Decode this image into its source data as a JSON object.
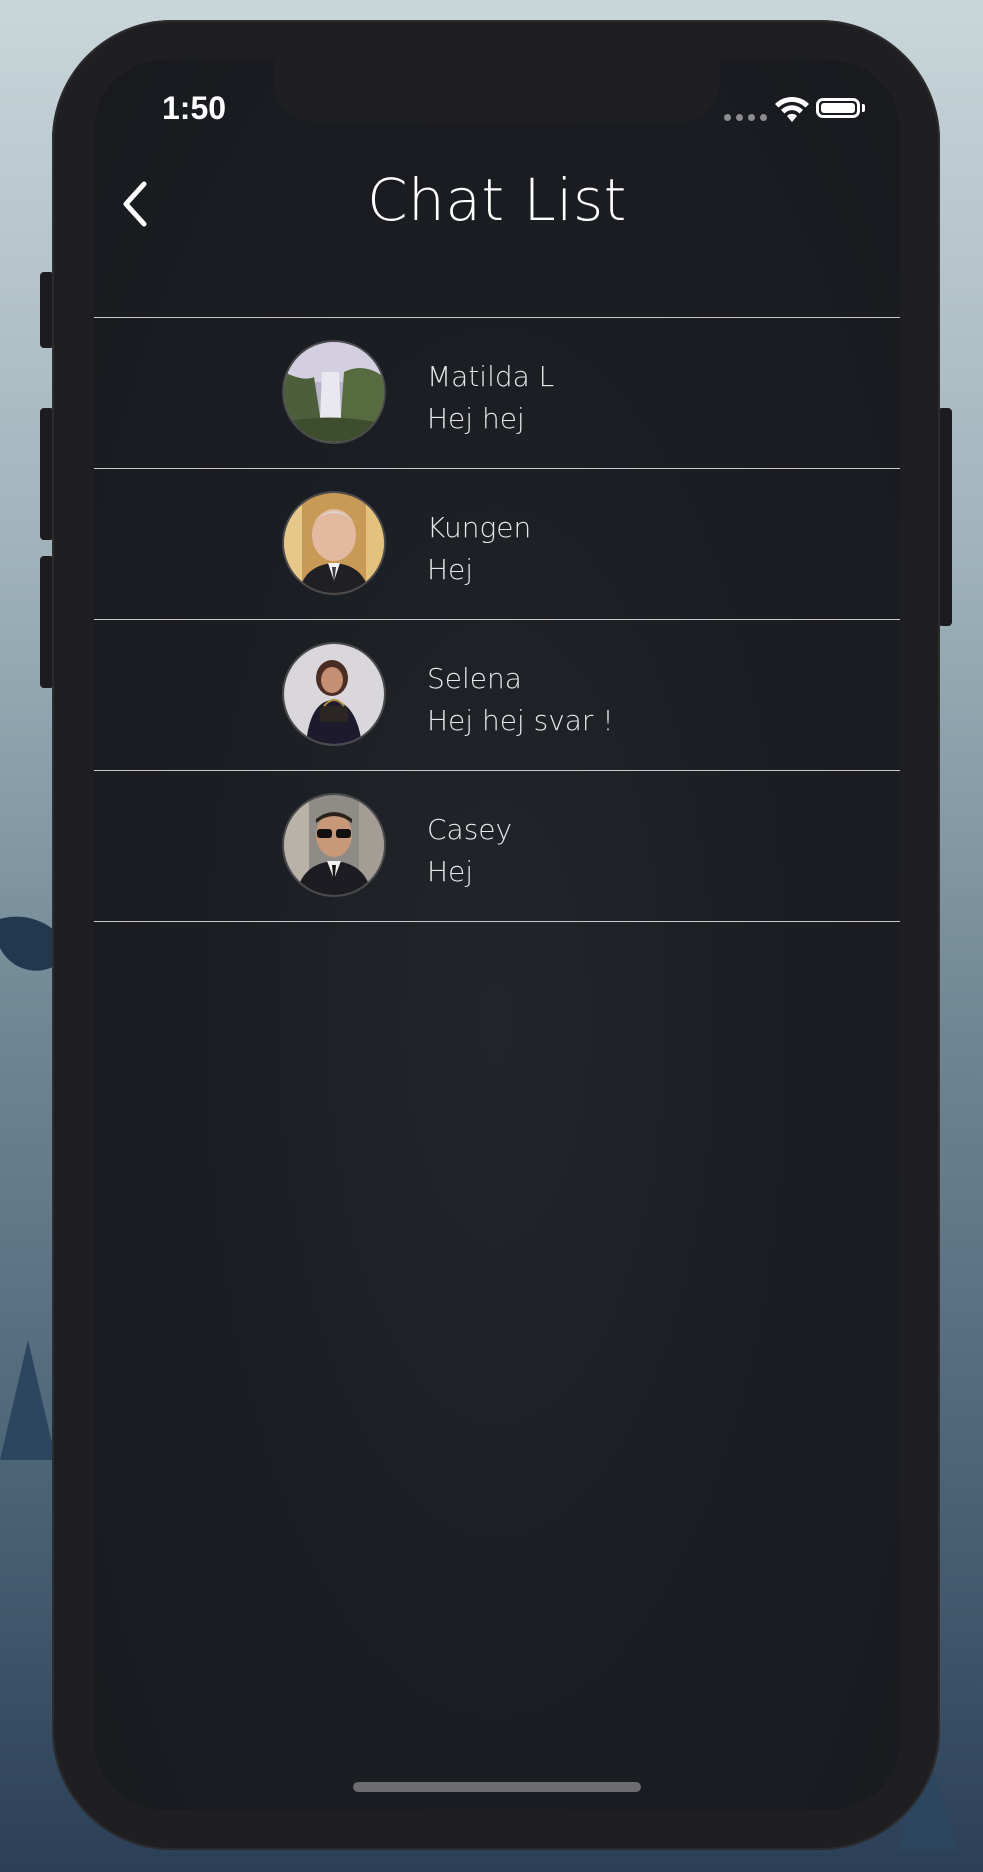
{
  "status_bar": {
    "time": "1:50",
    "icons": [
      "signal-dots-icon",
      "wifi-icon",
      "battery-icon"
    ]
  },
  "nav": {
    "title": "Chat List",
    "back_icon": "chevron-left-icon"
  },
  "chats": [
    {
      "name": "Matilda L",
      "message": "Hej hej",
      "avatar": "waterfall-photo"
    },
    {
      "name": "Kungen",
      "message": "Hej",
      "avatar": "man-portrait-photo"
    },
    {
      "name": "Selena",
      "message": "Hej hej svar !",
      "avatar": "woman-portrait-photo"
    },
    {
      "name": "Casey",
      "message": "Hej",
      "avatar": "man-sunglasses-photo"
    }
  ],
  "colors": {
    "screen_background": "#1a1d22",
    "divider": "#c9c9cb",
    "text": "#e9e9ea"
  }
}
